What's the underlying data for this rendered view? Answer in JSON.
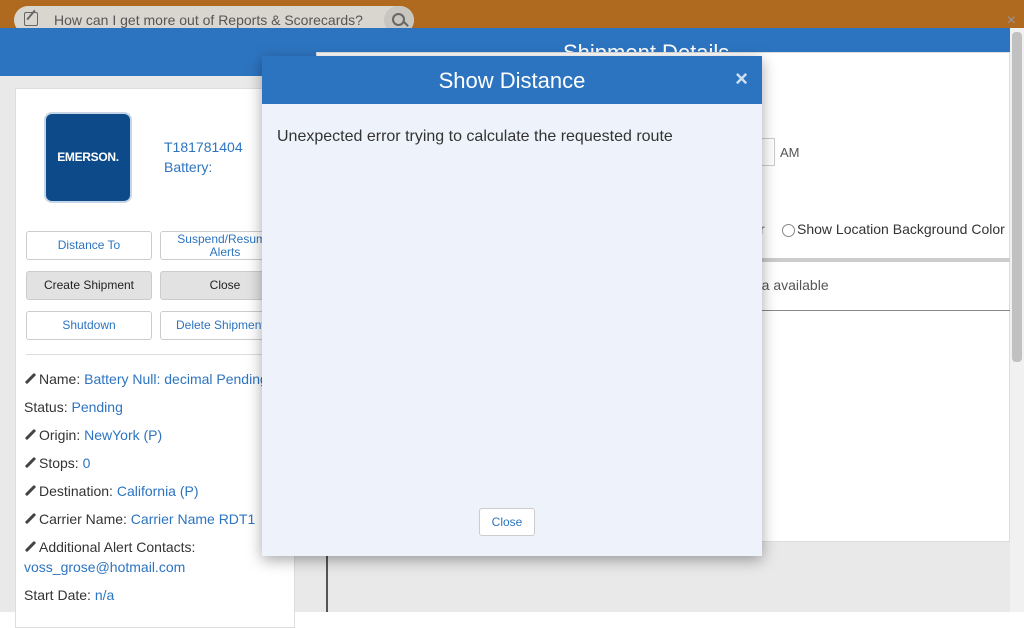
{
  "topbar": {
    "search_text": "How can I get more out of Reports & Scorecards?"
  },
  "header": {
    "title": "Shipment Details"
  },
  "device": {
    "logo_text": "EMERSON.",
    "id": "T181781404",
    "battery_label": "Battery:"
  },
  "actions": {
    "distance_to": "Distance To",
    "suspend_resume": "Suspend/Resume Alerts",
    "create_shipment": "Create Shipment",
    "close": "Close",
    "shutdown": "Shutdown",
    "delete_shipment": "Delete Shipment"
  },
  "fields": {
    "name_label": "Name:",
    "name_value": "Battery Null: decimal Pending",
    "status_label": "Status:",
    "status_value": "Pending",
    "origin_label": "Origin:",
    "origin_value": "NewYork (P)",
    "stops_label": "Stops:",
    "stops_value": "0",
    "destination_label": "Destination:",
    "destination_value": "California (P)",
    "carrier_label": "Carrier Name:",
    "carrier_value": "Carrier Name RDT1",
    "alert_contacts_label": "Additional Alert Contacts:",
    "alert_contacts_value": "voss_grose@hotmail.com",
    "start_date_label": "Start Date:",
    "start_date_value": "n/a"
  },
  "right_panel": {
    "am_box": "M",
    "am_label": "AM",
    "radio_partial": "r",
    "radio_label": "Show Location Background Color",
    "no_data": "ata available"
  },
  "modal": {
    "title": "Show Distance",
    "close_icon": "×",
    "message": "Unexpected error trying to calculate the requested route",
    "close_button": "Close"
  }
}
